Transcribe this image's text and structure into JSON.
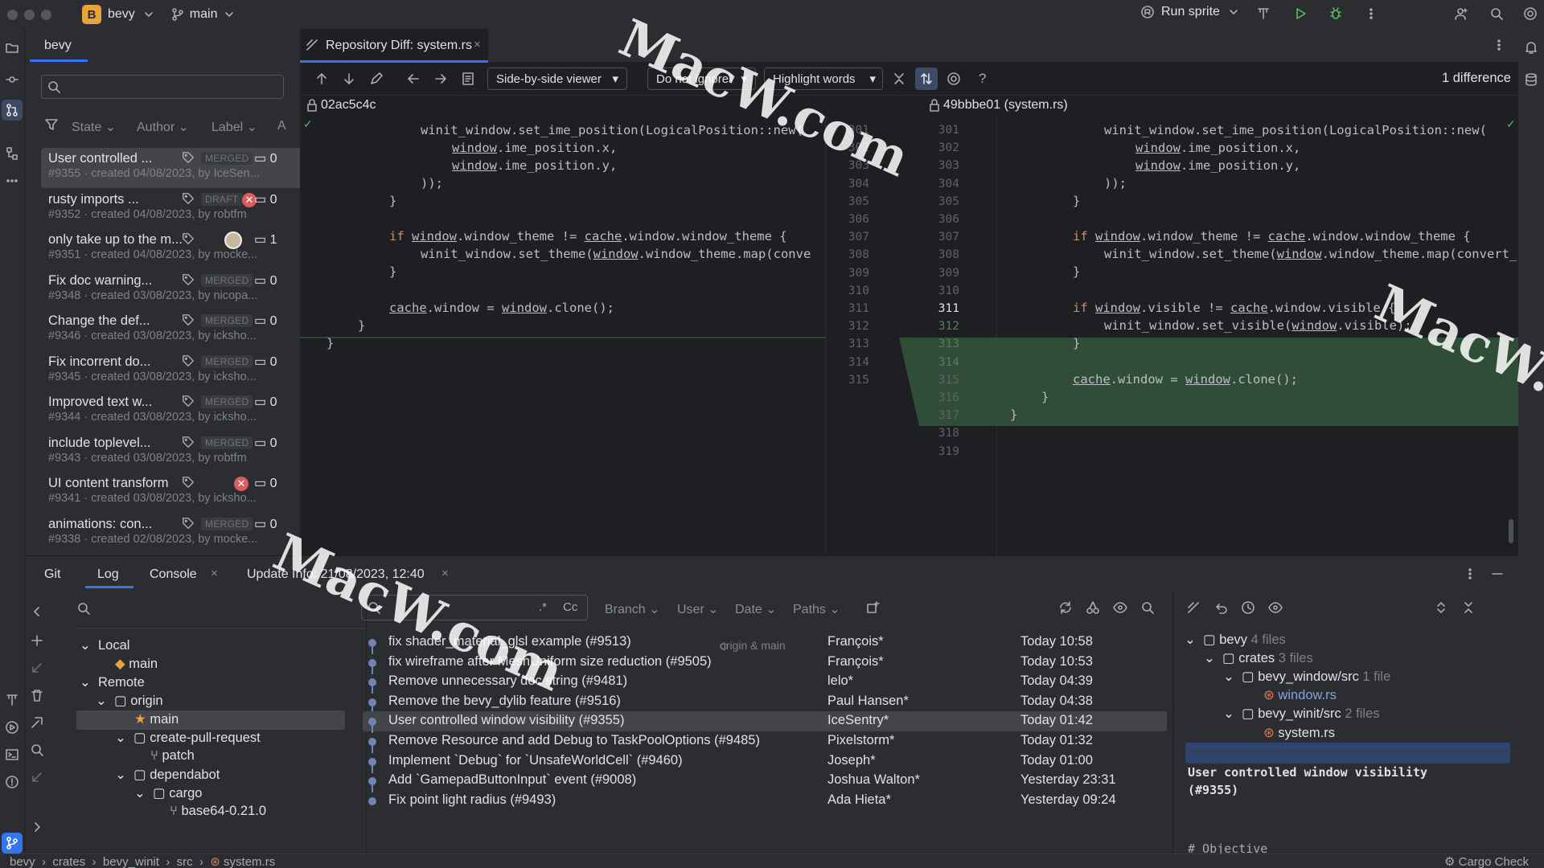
{
  "titlebar": {
    "project_letter": "B",
    "project": "bevy",
    "branch": "main",
    "run_config": "Run sprite"
  },
  "pr_panel": {
    "tab": "bevy",
    "search_placeholder": "",
    "filters": [
      "State",
      "Author",
      "Label",
      "A"
    ],
    "items": [
      {
        "title": "User controlled ...",
        "badge": "MERGED",
        "comments": "0",
        "meta": "#9355 · created 04/08/2023, by IceSen..."
      },
      {
        "title": "rusty imports ...",
        "badge": "DRAFT",
        "failed": true,
        "comments": "0",
        "meta": "#9352 · created 04/08/2023, by robtfm"
      },
      {
        "title": "only take up to the m...",
        "badge": "",
        "avatar": true,
        "comments": "1",
        "meta": "#9351 · created 04/08/2023, by mocke..."
      },
      {
        "title": "Fix doc warning...",
        "badge": "MERGED",
        "comments": "0",
        "meta": "#9348 · created 03/08/2023, by nicopa..."
      },
      {
        "title": "Change the def...",
        "badge": "MERGED",
        "comments": "0",
        "meta": "#9346 · created 03/08/2023, by ickshо..."
      },
      {
        "title": "Fix incorrent do...",
        "badge": "MERGED",
        "comments": "0",
        "meta": "#9345 · created 03/08/2023, by ickshо..."
      },
      {
        "title": "Improved text w...",
        "badge": "MERGED",
        "comments": "0",
        "meta": "#9344 · created 03/08/2023, by ickshо..."
      },
      {
        "title": "include toplevel...",
        "badge": "MERGED",
        "comments": "0",
        "meta": "#9343 · created 03/08/2023, by robtfm"
      },
      {
        "title": "UI content transform",
        "badge": "",
        "failed": true,
        "comments": "0",
        "meta": "#9341 · created 03/08/2023, by ickshо..."
      },
      {
        "title": "animations: con...",
        "badge": "MERGED",
        "comments": "0",
        "meta": "#9338 · created 02/08/2023, by mocke..."
      }
    ]
  },
  "diff": {
    "tab_title": "Repository Diff: system.rs",
    "viewer": "Side-by-side viewer",
    "ignore": "Do not ignore",
    "highlight": "Highlight words",
    "difference_count": "1 difference",
    "left_rev": "02ac5c4c",
    "right_rev": "49bbbe01 (system.rs)",
    "left_nums": [
      "301",
      "302",
      "303",
      "304",
      "305",
      "306",
      "307",
      "308",
      "309",
      "310",
      "311",
      "312",
      "313",
      "314",
      "315"
    ],
    "right_nums": [
      "301",
      "302",
      "303",
      "304",
      "305",
      "306",
      "307",
      "308",
      "309",
      "310",
      "311",
      "312",
      "313",
      "314",
      "315",
      "316",
      "317",
      "318",
      "319"
    ]
  },
  "bottom": {
    "tabs": [
      "Git",
      "Log",
      "Console",
      "Update Info: 21/08/2023, 12:40"
    ],
    "tree": {
      "local": "Local",
      "local_main": "main",
      "remote": "Remote",
      "origin": "origin",
      "origin_main": "main",
      "cpr": "create-pull-request",
      "patch": "patch",
      "dependabot": "dependabot",
      "cargo": "cargo",
      "base64": "base64-0.21.0"
    },
    "log_filters": [
      "Branch",
      "User",
      "Date",
      "Paths"
    ],
    "log": [
      {
        "msg": "fix shader_material_glsl example (#9513)",
        "refs": "origin & main",
        "author": "François*",
        "date": "Today 10:58"
      },
      {
        "msg": "fix wireframe after MeshUniform size reduction (#9505)",
        "refs": "",
        "author": "François*",
        "date": "Today 10:53"
      },
      {
        "msg": "Remove unnecessary doc string (#9481)",
        "refs": "",
        "author": "lelo*",
        "date": "Today 04:39"
      },
      {
        "msg": "Remove the bevy_dylib feature (#9516)",
        "refs": "",
        "author": "Paul Hansen*",
        "date": "Today 04:38"
      },
      {
        "msg": "User controlled window visibility (#9355)",
        "refs": "",
        "author": "IceSentry*",
        "date": "Today 01:42"
      },
      {
        "msg": "Remove Resource and add Debug to TaskPoolOptions (#9485)",
        "refs": "",
        "author": "Pixelstorm*",
        "date": "Today 01:32"
      },
      {
        "msg": "Implement `Debug` for `UnsafeWorldCell` (#9460)",
        "refs": "",
        "author": "Joseph*",
        "date": "Today 01:00"
      },
      {
        "msg": "Add `GamepadButtonInput` event (#9008)",
        "refs": "",
        "author": "Joshua Walton*",
        "date": "Yesterday 23:31"
      },
      {
        "msg": "Fix point light radius (#9493)",
        "refs": "",
        "author": "Ada Hieta*",
        "date": "Yesterday 09:24"
      }
    ],
    "changes": {
      "root": "bevy",
      "root_count": "4 files",
      "crates": "crates",
      "crates_count": "3 files",
      "bw": "bevy_window/src",
      "bw_count": "1 file",
      "windowrs": "window.rs",
      "bwi": "bevy_winit/src",
      "bwi_count": "2 files",
      "systemrs": "system.rs"
    },
    "commit_title": "User controlled window visibility\n(#9355)",
    "commit_next": "# Objective"
  },
  "statusbar": {
    "crumbs": [
      "bevy",
      "crates",
      "bevy_winit",
      "src",
      "system.rs"
    ],
    "right": "Cargo Check"
  },
  "watermark": "MacW.com",
  "colors": {
    "accent": "#3574f0",
    "added": "#2f4d37",
    "selected_row": "#2e436e"
  }
}
